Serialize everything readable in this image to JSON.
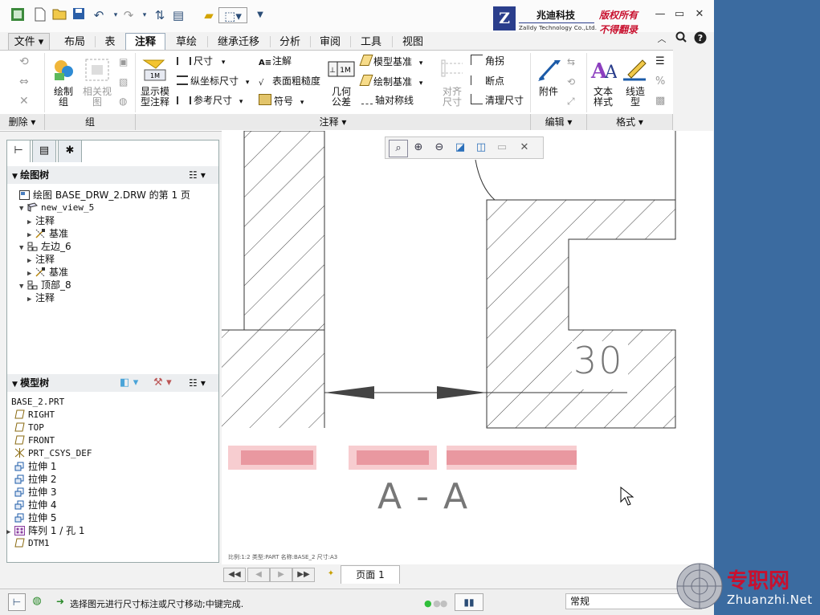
{
  "app": {
    "brand_name": "兆迪科技",
    "brand_subtitle": "Zalldy Technology Co.,Ltd.",
    "brand_tag1": "版权所有",
    "brand_tag2": "不得翻录",
    "logo_text": "ZD"
  },
  "tabs": [
    {
      "label": "文件 ▾"
    },
    {
      "label": "布局"
    },
    {
      "label": "表"
    },
    {
      "label": "注释"
    },
    {
      "label": "草绘"
    },
    {
      "label": "继承迁移"
    },
    {
      "label": "分析"
    },
    {
      "label": "审阅"
    },
    {
      "label": "工具"
    },
    {
      "label": "视图"
    }
  ],
  "active_tab": "注释",
  "ribbon": {
    "delete_group": "删除",
    "group_group": "组",
    "annot_group": "注释",
    "edit_group": "编辑",
    "format_group": "格式",
    "draw_group": "绘制\n组",
    "related_view": "相关视\n图",
    "show_model": "显示模\n型注释",
    "dim": "尺寸",
    "ord_dim": "纵坐标尺寸",
    "ref_dim": "参考尺寸",
    "note": "注解",
    "surface_finish": "表面粗糙度",
    "symbol": "符号",
    "gtol": "几何\n公差",
    "model_datum": "模型基准",
    "draw_datum": "绘制基准",
    "axis_sym": "轴对称线",
    "align_dim": "对齐\n尺寸",
    "angle": "角拐",
    "breakpoint": "断点",
    "cleanup_dim": "清理尺寸",
    "attach": "附件",
    "text_style": "文本\n样式",
    "line_style": "线造\n型"
  },
  "panel": {
    "drawing_tree_title": "绘图树",
    "model_tree_title": "模型树",
    "drawing_tree": [
      {
        "label": "绘图 BASE_DRW_2.DRW 的第 1 页",
        "level": 0,
        "exp": "",
        "icon": "drawing"
      },
      {
        "label": "new_view_5",
        "level": 1,
        "exp": "▼",
        "icon": "view"
      },
      {
        "label": "注释",
        "level": 2,
        "exp": "▶",
        "icon": ""
      },
      {
        "label": "基准",
        "level": 2,
        "exp": "▶",
        "icon": "datum"
      },
      {
        "label": "左边_6",
        "level": 1,
        "exp": "▼",
        "icon": "view2"
      },
      {
        "label": "注释",
        "level": 2,
        "exp": "▶",
        "icon": ""
      },
      {
        "label": "基准",
        "level": 2,
        "exp": "▶",
        "icon": "datum"
      },
      {
        "label": "顶部_8",
        "level": 1,
        "exp": "▼",
        "icon": "view2"
      },
      {
        "label": "注释",
        "level": 2,
        "exp": "▶",
        "icon": ""
      }
    ],
    "model_tree": [
      {
        "label": "BASE_2.PRT",
        "icon": "",
        "exp": ""
      },
      {
        "label": "RIGHT",
        "icon": "plane",
        "exp": ""
      },
      {
        "label": "TOP",
        "icon": "plane",
        "exp": ""
      },
      {
        "label": "FRONT",
        "icon": "plane",
        "exp": ""
      },
      {
        "label": "PRT_CSYS_DEF",
        "icon": "csys",
        "exp": ""
      },
      {
        "label": "拉伸 1",
        "icon": "extrude",
        "exp": ""
      },
      {
        "label": "拉伸 2",
        "icon": "extrude",
        "exp": ""
      },
      {
        "label": "拉伸 3",
        "icon": "extrude",
        "exp": ""
      },
      {
        "label": "拉伸 4",
        "icon": "extrude",
        "exp": ""
      },
      {
        "label": "拉伸 5",
        "icon": "extrude",
        "exp": ""
      },
      {
        "label": "阵列 1 / 孔 1",
        "icon": "pattern",
        "exp": "▶"
      },
      {
        "label": "DTM1",
        "icon": "plane",
        "exp": ""
      }
    ]
  },
  "canvas": {
    "dimension_value": "30",
    "section_label": "A - A",
    "footer_info": "比例:1:2    类型:PART    名称:BASE_2    尺寸:A3"
  },
  "pagebar": {
    "page_label": "页面 1"
  },
  "status": {
    "message": "选择图元进行尺寸标注或尺寸移动;中键完成.",
    "filter_value": "常规"
  },
  "watermark": {
    "title": "专职网",
    "url": "Zhuanzhi.Net"
  },
  "colors": {
    "accent": "#2a3e8c",
    "desktop": "#3b6ba0",
    "brand_red": "#c8102e"
  }
}
